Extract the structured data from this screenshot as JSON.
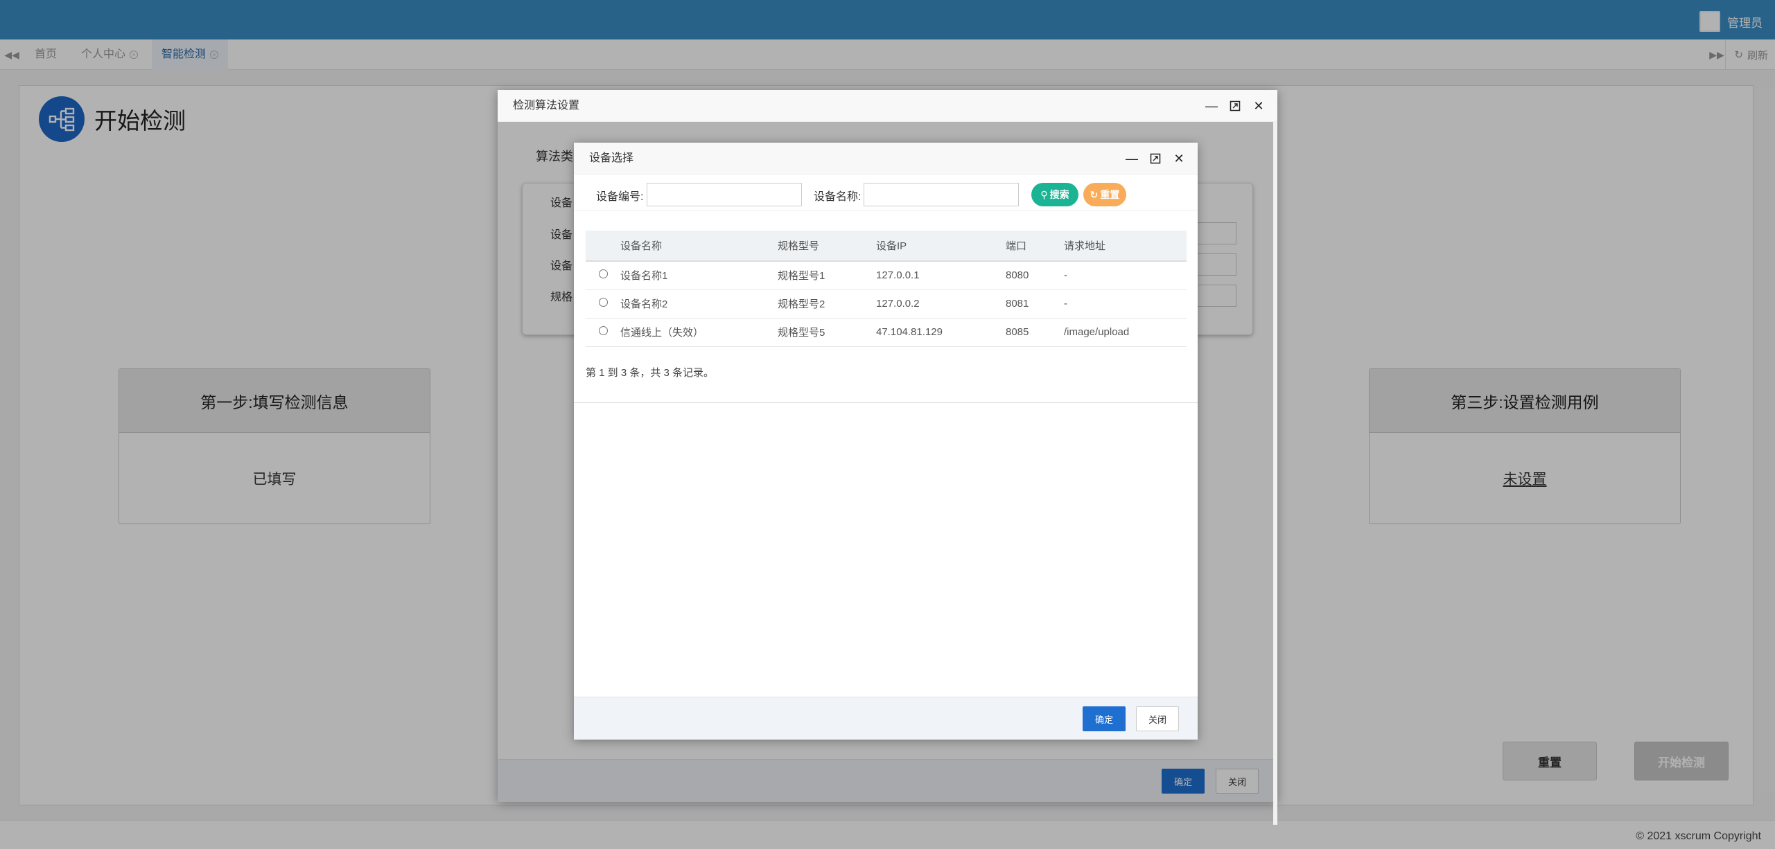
{
  "header": {
    "admin_label": "管理员"
  },
  "tabs": {
    "items": [
      {
        "label": "首页",
        "closable": false
      },
      {
        "label": "个人中心",
        "closable": true
      },
      {
        "label": "智能检测",
        "closable": true
      }
    ],
    "refresh_label": "刷新"
  },
  "page": {
    "title": "开始检测",
    "step1": {
      "title": "第一步:填写检测信息",
      "status": "已填写"
    },
    "step3": {
      "title": "第三步:设置检测用例",
      "status": "未设置"
    },
    "reset_label": "重置",
    "start_label": "开始检测"
  },
  "outer_dialog": {
    "title": "检测算法设置",
    "field_labels": [
      "算法类",
      "设备",
      "设备",
      "设备",
      "规格"
    ],
    "ok_label": "确定",
    "close_label": "关闭"
  },
  "inner_dialog": {
    "title": "设备选择",
    "search": {
      "code_label": "设备编号:",
      "code_value": "",
      "name_label": "设备名称:",
      "name_value": "",
      "search_label": "搜索",
      "reset_label": "重置"
    },
    "table": {
      "columns": [
        "设备名称",
        "规格型号",
        "设备IP",
        "端口",
        "请求地址"
      ],
      "rows": [
        {
          "name": "设备名称1",
          "model": "规格型号1",
          "ip": "127.0.0.1",
          "port": "8080",
          "url": "-"
        },
        {
          "name": "设备名称2",
          "model": "规格型号2",
          "ip": "127.0.0.2",
          "port": "8081",
          "url": "-"
        },
        {
          "name": "信通线上（失效）",
          "model": "规格型号5",
          "ip": "47.104.81.129",
          "port": "8085",
          "url": "/image/upload"
        }
      ]
    },
    "pager_text": "第 1 到 3 条，共 3 条记录。",
    "ok_label": "确定",
    "close_label": "关闭"
  },
  "footer": {
    "copyright": "© 2021 xscrum Copyright"
  },
  "colors": {
    "topbar": "#3c8dc5",
    "primary_button": "#1f6fd1",
    "search_button": "#1ab394",
    "reset_button": "#f8ac59",
    "head_icon": "#1f67c6"
  }
}
